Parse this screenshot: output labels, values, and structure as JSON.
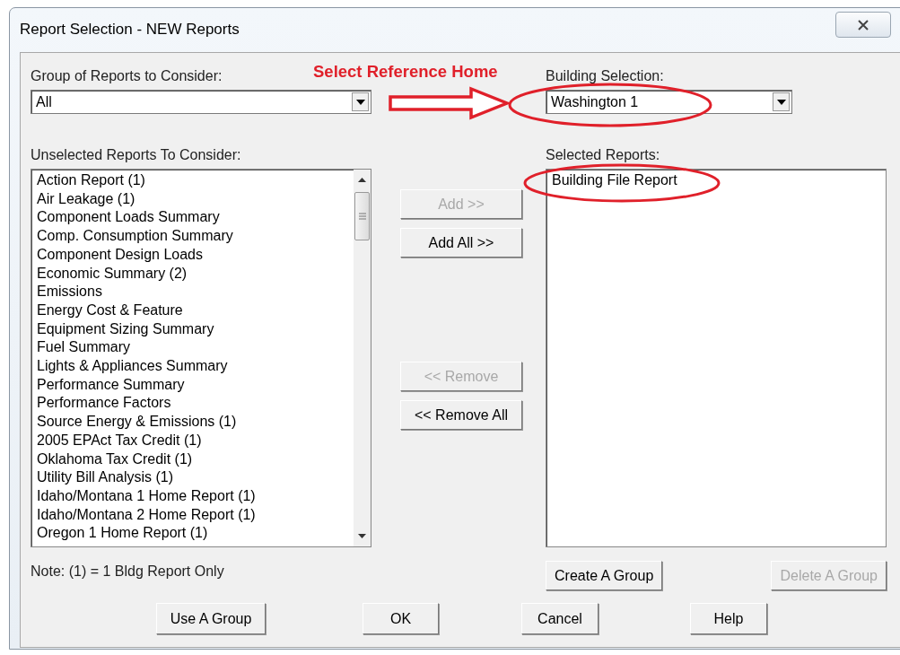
{
  "window": {
    "title": "Report Selection - NEW Reports"
  },
  "group_field": {
    "label": "Group of Reports to Consider:",
    "value": "All"
  },
  "annotation": {
    "text": "Select Reference Home"
  },
  "building_field": {
    "label": "Building Selection:",
    "value": "Washington 1"
  },
  "unselected": {
    "label": "Unselected Reports To Consider:",
    "items": [
      "Action Report (1)",
      "Air Leakage (1)",
      "Component Loads Summary",
      "Comp. Consumption Summary",
      "Component Design Loads",
      "Economic Summary (2)",
      "Emissions",
      "Energy Cost & Feature",
      "Equipment Sizing Summary",
      "Fuel Summary",
      "Lights & Appliances Summary",
      "Performance Summary",
      "Performance Factors",
      "Source Energy & Emissions (1)",
      "2005 EPAct Tax Credit (1)",
      "Oklahoma Tax Credit (1)",
      "Utility Bill Analysis (1)",
      "Idaho/Montana 1 Home Report (1)",
      "Idaho/Montana 2 Home Report (1)",
      "Oregon 1 Home Report (1)"
    ]
  },
  "selected": {
    "label": "Selected Reports:",
    "items": [
      "Building File Report"
    ]
  },
  "move_buttons": [
    {
      "label": "Add >>",
      "disabled": true
    },
    {
      "label": "Add All >>",
      "disabled": false
    },
    {
      "label": "<< Remove",
      "disabled": true
    },
    {
      "label": "<< Remove All",
      "disabled": false
    }
  ],
  "note": "Note: (1) = 1 Bldg Report Only",
  "group_buttons": [
    {
      "label": "Create A Group",
      "disabled": false
    },
    {
      "label": "Delete A Group",
      "disabled": true
    }
  ],
  "buttons": [
    "Use A Group",
    "OK",
    "Cancel",
    "Help"
  ]
}
